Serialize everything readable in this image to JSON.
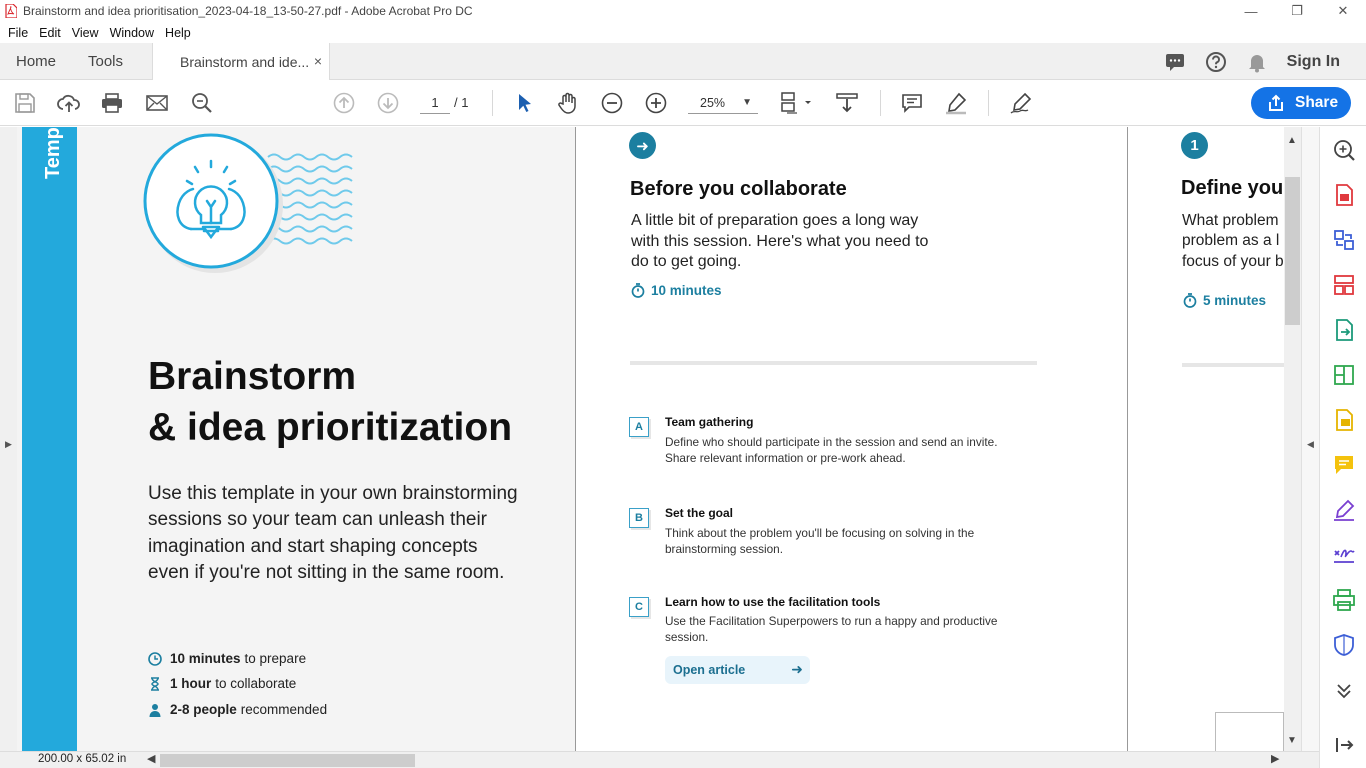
{
  "window": {
    "title": "Brainstorm and idea prioritisation_2023-04-18_13-50-27.pdf - Adobe Acrobat Pro DC",
    "controls": {
      "minimize": "—",
      "restore": "❐",
      "close": "✕"
    }
  },
  "menu": [
    "File",
    "Edit",
    "View",
    "Window",
    "Help"
  ],
  "tabs": {
    "home": "Home",
    "tools": "Tools",
    "document": "Brainstorm and ide...",
    "close": "×"
  },
  "header_right": {
    "sign_in": "Sign In"
  },
  "toolbar": {
    "page_current": "1",
    "page_total": "/ 1",
    "zoom": "25%",
    "share": "Share"
  },
  "doc": {
    "side_strip_text": "Temp",
    "title_line1": "Brainstorm",
    "title_line2": "& idea prioritization",
    "intro": "Use this template in your own brainstorming sessions so your team can unleash their imagination and start shaping concepts even if you're not sitting in the same room.",
    "meta": [
      {
        "bold": "10 minutes",
        "rest": "to prepare"
      },
      {
        "bold": "1 hour",
        "rest": "to collaborate"
      },
      {
        "bold": "2-8 people",
        "rest": "recommended"
      }
    ],
    "before": {
      "title": "Before you collaborate",
      "text": "A little bit of preparation goes a long way with this session. Here's what you need to do to get going.",
      "duration": "10 minutes"
    },
    "steps": [
      {
        "letter": "A",
        "title": "Team gathering",
        "text": "Define who should participate in the session and send an invite. Share relevant information or pre-work ahead."
      },
      {
        "letter": "B",
        "title": "Set the goal",
        "text": "Think about the problem you'll be focusing on solving in the brainstorming session."
      },
      {
        "letter": "C",
        "title": "Learn how to use the facilitation tools",
        "text": "Use the Facilitation Superpowers to run a happy and productive session."
      }
    ],
    "open_article": "Open article",
    "define": {
      "badge": "1",
      "title": "Define you",
      "text_lines": [
        "What problem",
        "problem as a l",
        "focus of your b"
      ],
      "duration": "5 minutes"
    }
  },
  "status": {
    "dimensions": "200.00 x 65.02 in"
  },
  "colors": {
    "accent": "#1473e6",
    "brand_teal": "#1c7fa0",
    "strip_blue": "#23a9dc"
  }
}
